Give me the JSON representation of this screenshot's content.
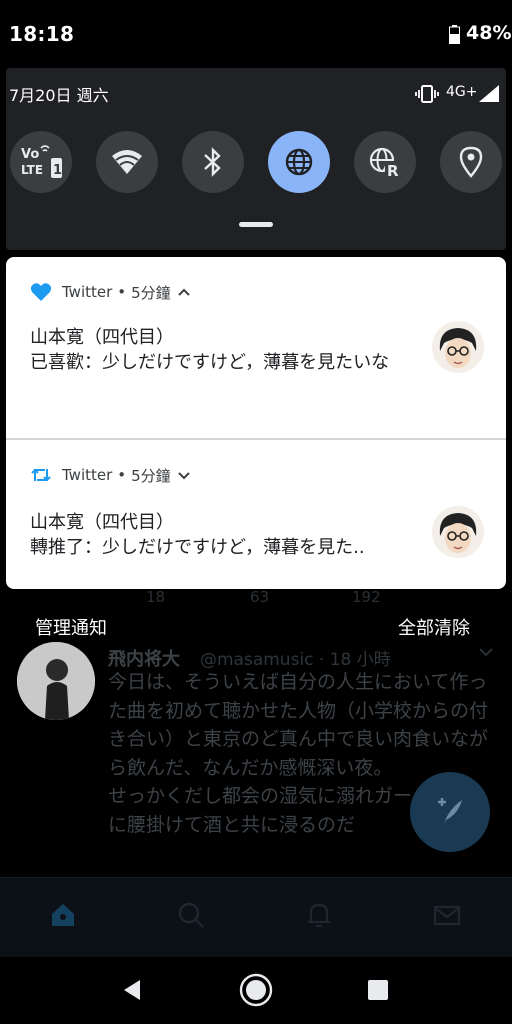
{
  "status_bar": {
    "time": "18:18",
    "battery": "48%"
  },
  "quick_settings": {
    "date": "7月20日 週六",
    "network": "4G+",
    "tiles": [
      {
        "name": "volte",
        "icon": "volte-lte-icon",
        "active": false
      },
      {
        "name": "wifi",
        "icon": "wifi-icon",
        "active": false
      },
      {
        "name": "bluetooth",
        "icon": "bluetooth-icon",
        "active": false
      },
      {
        "name": "mobile-data",
        "icon": "globe-icon",
        "active": true
      },
      {
        "name": "roaming",
        "icon": "globe-roaming-icon",
        "active": false
      },
      {
        "name": "location",
        "icon": "location-pin-icon",
        "active": false
      }
    ]
  },
  "notifications": [
    {
      "app": "Twitter",
      "sep": "•",
      "time": "5分鐘",
      "icon": "heart-icon",
      "expanded": true,
      "title": "山本寛（四代目）",
      "text": "已喜歡：少しだけですけど，薄暮を見たいな"
    },
    {
      "app": "Twitter",
      "sep": "•",
      "time": "5分鐘",
      "icon": "retweet-icon",
      "expanded": false,
      "title": "山本寛（四代目）",
      "text": "轉推了：少しだけですけど，薄暮を見た.."
    }
  ],
  "actions": {
    "manage": "管理通知",
    "clear_all": "全部清除"
  },
  "background_tweet": {
    "stats": [
      "18",
      "63",
      "192"
    ],
    "name": "飛内将大",
    "handle": "@masamusic · 18 小時",
    "body": "今日は、そういえば自分の人生において作った曲を初めて聴かせた人物（小学校からの付き合い）と東京のど真ん中で良い肉食いながら飲んだ、なんだか感慨深い夜。\nせっかくだし都会の湿気に溺れガードレールに腰掛けて酒と共に浸るのだ"
  },
  "colors": {
    "accent": "#8ab4f8",
    "twitter_blue": "#1d9bf0",
    "panel": "#202124"
  }
}
